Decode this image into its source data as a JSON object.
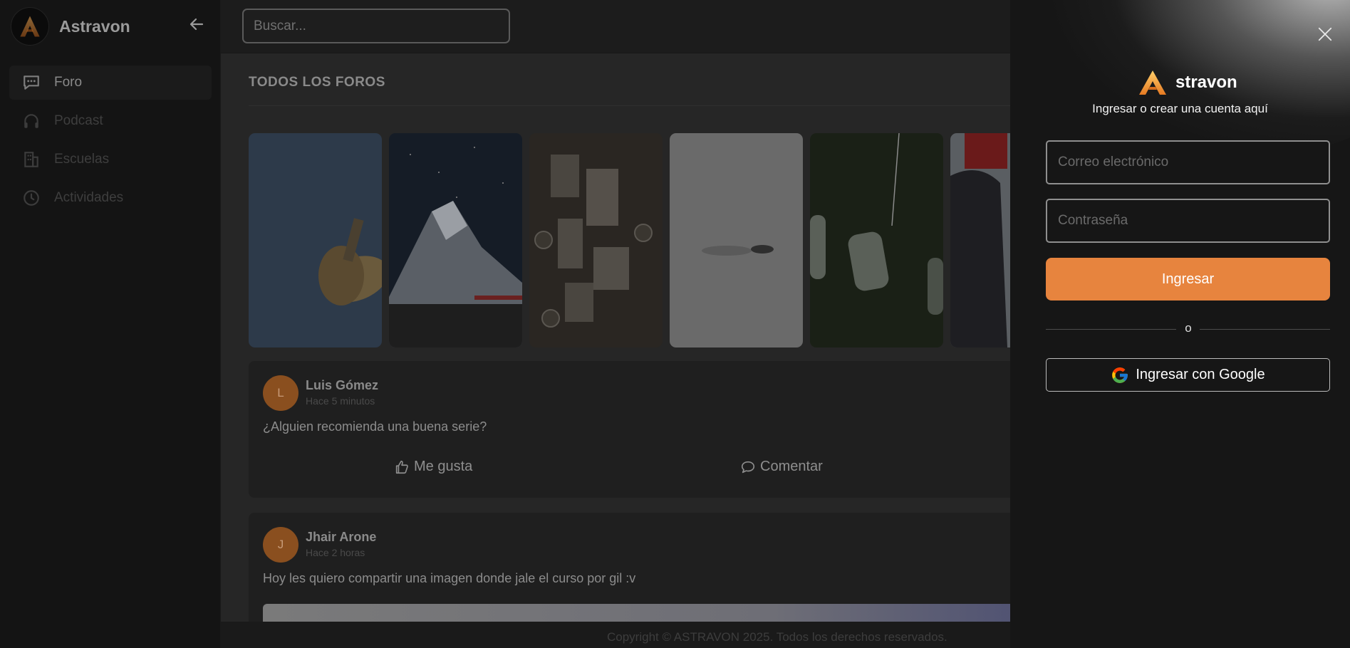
{
  "brand": {
    "name": "Astravon"
  },
  "search": {
    "placeholder": "Buscar..."
  },
  "sidebar": {
    "items": [
      {
        "label": "Foro",
        "icon": "forum-icon",
        "active": true
      },
      {
        "label": "Podcast",
        "icon": "headphones-icon",
        "active": false
      },
      {
        "label": "Escuelas",
        "icon": "building-icon",
        "active": false
      },
      {
        "label": "Actividades",
        "icon": "clock-icon",
        "active": false
      }
    ]
  },
  "main": {
    "section_title": "TODOS LOS FOROS",
    "stories": [
      {
        "subject": "brass horn against blue sky"
      },
      {
        "subject": "snowy mountain under starry night"
      },
      {
        "subject": "wooden plaques with coins"
      },
      {
        "subject": "figure lying in white snow"
      },
      {
        "subject": "hanging glass bottles"
      },
      {
        "subject": "person in red and dark jacket"
      }
    ],
    "posts": [
      {
        "avatar_initial": "L",
        "author": "Luis Gómez",
        "time": "Hace 5 minutos",
        "text": "¿Alguien recomienda una buena serie?",
        "like_label": "Me gusta",
        "comment_label": "Comentar"
      },
      {
        "avatar_initial": "J",
        "author": "Jhair Arone",
        "time": "Hace 2 horas",
        "text": "Hoy les quiero compartir una imagen donde jale el curso por gil :v"
      }
    ]
  },
  "footer": {
    "copyright": "Copyright © ASTRAVON 2025. Todos los derechos reservados."
  },
  "login": {
    "brand_name": "stravon",
    "subtitle": "Ingresar o crear una cuenta aquí",
    "email_placeholder": "Correo electrónico",
    "password_placeholder": "Contraseña",
    "submit_label": "Ingresar",
    "or_label": "o",
    "google_label": "Ingresar con Google"
  },
  "colors": {
    "accent": "#e7843e",
    "drawer_bg": "#161616",
    "page_bg": "#262626",
    "avatar": "#8a4f1f"
  }
}
